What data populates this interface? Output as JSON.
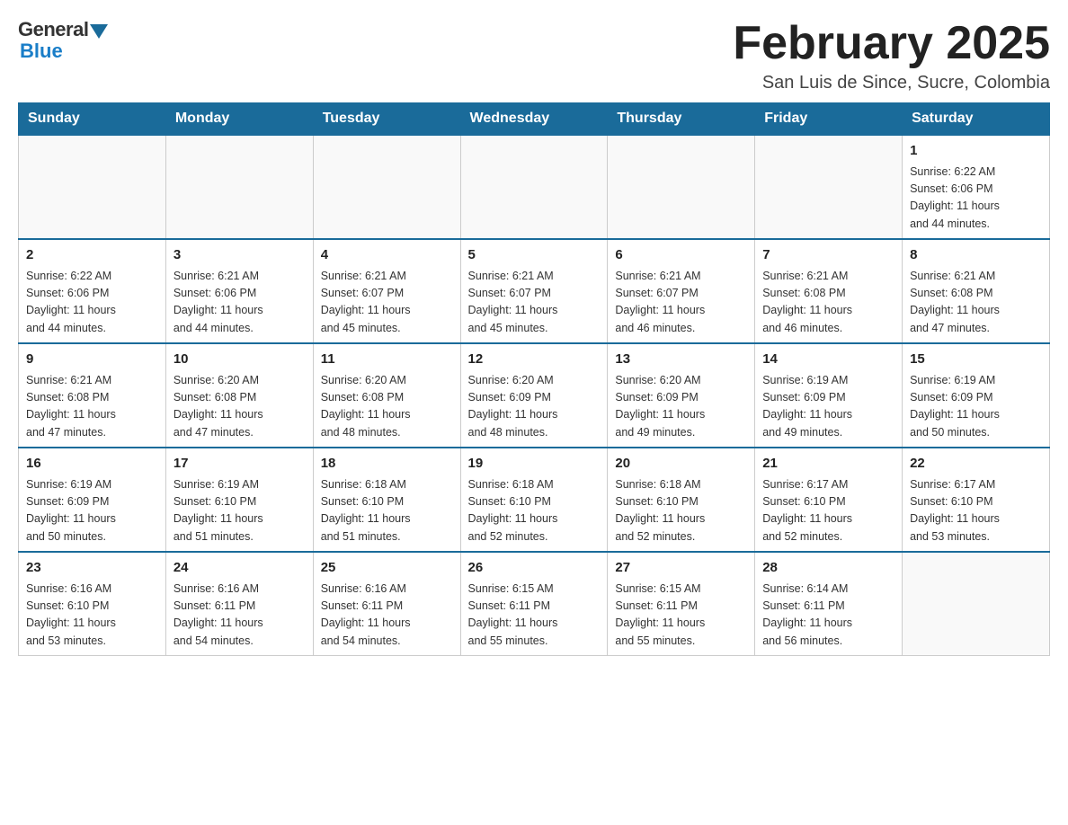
{
  "logo": {
    "general": "General",
    "blue": "Blue"
  },
  "title": "February 2025",
  "location": "San Luis de Since, Sucre, Colombia",
  "days_of_week": [
    "Sunday",
    "Monday",
    "Tuesday",
    "Wednesday",
    "Thursday",
    "Friday",
    "Saturday"
  ],
  "weeks": [
    [
      {
        "day": "",
        "info": ""
      },
      {
        "day": "",
        "info": ""
      },
      {
        "day": "",
        "info": ""
      },
      {
        "day": "",
        "info": ""
      },
      {
        "day": "",
        "info": ""
      },
      {
        "day": "",
        "info": ""
      },
      {
        "day": "1",
        "info": "Sunrise: 6:22 AM\nSunset: 6:06 PM\nDaylight: 11 hours\nand 44 minutes."
      }
    ],
    [
      {
        "day": "2",
        "info": "Sunrise: 6:22 AM\nSunset: 6:06 PM\nDaylight: 11 hours\nand 44 minutes."
      },
      {
        "day": "3",
        "info": "Sunrise: 6:21 AM\nSunset: 6:06 PM\nDaylight: 11 hours\nand 44 minutes."
      },
      {
        "day": "4",
        "info": "Sunrise: 6:21 AM\nSunset: 6:07 PM\nDaylight: 11 hours\nand 45 minutes."
      },
      {
        "day": "5",
        "info": "Sunrise: 6:21 AM\nSunset: 6:07 PM\nDaylight: 11 hours\nand 45 minutes."
      },
      {
        "day": "6",
        "info": "Sunrise: 6:21 AM\nSunset: 6:07 PM\nDaylight: 11 hours\nand 46 minutes."
      },
      {
        "day": "7",
        "info": "Sunrise: 6:21 AM\nSunset: 6:08 PM\nDaylight: 11 hours\nand 46 minutes."
      },
      {
        "day": "8",
        "info": "Sunrise: 6:21 AM\nSunset: 6:08 PM\nDaylight: 11 hours\nand 47 minutes."
      }
    ],
    [
      {
        "day": "9",
        "info": "Sunrise: 6:21 AM\nSunset: 6:08 PM\nDaylight: 11 hours\nand 47 minutes."
      },
      {
        "day": "10",
        "info": "Sunrise: 6:20 AM\nSunset: 6:08 PM\nDaylight: 11 hours\nand 47 minutes."
      },
      {
        "day": "11",
        "info": "Sunrise: 6:20 AM\nSunset: 6:08 PM\nDaylight: 11 hours\nand 48 minutes."
      },
      {
        "day": "12",
        "info": "Sunrise: 6:20 AM\nSunset: 6:09 PM\nDaylight: 11 hours\nand 48 minutes."
      },
      {
        "day": "13",
        "info": "Sunrise: 6:20 AM\nSunset: 6:09 PM\nDaylight: 11 hours\nand 49 minutes."
      },
      {
        "day": "14",
        "info": "Sunrise: 6:19 AM\nSunset: 6:09 PM\nDaylight: 11 hours\nand 49 minutes."
      },
      {
        "day": "15",
        "info": "Sunrise: 6:19 AM\nSunset: 6:09 PM\nDaylight: 11 hours\nand 50 minutes."
      }
    ],
    [
      {
        "day": "16",
        "info": "Sunrise: 6:19 AM\nSunset: 6:09 PM\nDaylight: 11 hours\nand 50 minutes."
      },
      {
        "day": "17",
        "info": "Sunrise: 6:19 AM\nSunset: 6:10 PM\nDaylight: 11 hours\nand 51 minutes."
      },
      {
        "day": "18",
        "info": "Sunrise: 6:18 AM\nSunset: 6:10 PM\nDaylight: 11 hours\nand 51 minutes."
      },
      {
        "day": "19",
        "info": "Sunrise: 6:18 AM\nSunset: 6:10 PM\nDaylight: 11 hours\nand 52 minutes."
      },
      {
        "day": "20",
        "info": "Sunrise: 6:18 AM\nSunset: 6:10 PM\nDaylight: 11 hours\nand 52 minutes."
      },
      {
        "day": "21",
        "info": "Sunrise: 6:17 AM\nSunset: 6:10 PM\nDaylight: 11 hours\nand 52 minutes."
      },
      {
        "day": "22",
        "info": "Sunrise: 6:17 AM\nSunset: 6:10 PM\nDaylight: 11 hours\nand 53 minutes."
      }
    ],
    [
      {
        "day": "23",
        "info": "Sunrise: 6:16 AM\nSunset: 6:10 PM\nDaylight: 11 hours\nand 53 minutes."
      },
      {
        "day": "24",
        "info": "Sunrise: 6:16 AM\nSunset: 6:11 PM\nDaylight: 11 hours\nand 54 minutes."
      },
      {
        "day": "25",
        "info": "Sunrise: 6:16 AM\nSunset: 6:11 PM\nDaylight: 11 hours\nand 54 minutes."
      },
      {
        "day": "26",
        "info": "Sunrise: 6:15 AM\nSunset: 6:11 PM\nDaylight: 11 hours\nand 55 minutes."
      },
      {
        "day": "27",
        "info": "Sunrise: 6:15 AM\nSunset: 6:11 PM\nDaylight: 11 hours\nand 55 minutes."
      },
      {
        "day": "28",
        "info": "Sunrise: 6:14 AM\nSunset: 6:11 PM\nDaylight: 11 hours\nand 56 minutes."
      },
      {
        "day": "",
        "info": ""
      }
    ]
  ]
}
